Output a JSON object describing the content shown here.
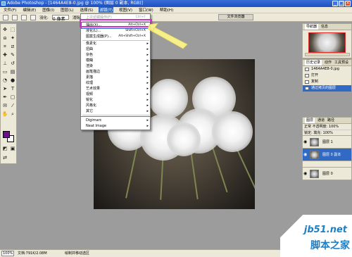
{
  "titlebar": {
    "title": "Adobe Photoshop - [1464A4E8-0.jpg @ 100% (图层 0 副本, RGB)]"
  },
  "menubar": {
    "items": [
      "文件(F)",
      "编辑(E)",
      "图像(I)",
      "图层(L)",
      "选择(S)",
      "滤镜(T)",
      "视图(V)",
      "窗口(W)",
      "帮助(H)"
    ],
    "active_index": 5
  },
  "options": {
    "feather_label": "羽化:",
    "feather_value": "0 像素",
    "smooth_label": "消除锯齿"
  },
  "file_browser": "文件浏览器",
  "filter_menu": {
    "last_filter": {
      "label": "上次滤镜操作(F)",
      "shortcut": "Ctrl+F"
    },
    "top": [
      {
        "label": "抽出(X)...",
        "shortcut": "Alt+Ctrl+X"
      },
      {
        "label": "液化(L)...",
        "shortcut": "Shift+Ctrl+X"
      },
      {
        "label": "图案生成器(P)...",
        "shortcut": "Alt+Shift+Ctrl+X"
      }
    ],
    "groups": [
      "像素化",
      "扭曲",
      "杂色",
      "模糊",
      "渲染",
      "画笔描边",
      "素描",
      "纹理",
      "艺术效果",
      "视频",
      "锐化",
      "风格化",
      "其它"
    ],
    "plugins": [
      "Digimarc",
      "Neat Image"
    ]
  },
  "navigator": {
    "tabs": [
      "导航器",
      "信息"
    ],
    "zoom": "100%"
  },
  "history": {
    "tabs": [
      "历史记录",
      "动作",
      "工具预设"
    ],
    "items": [
      "1464A4E8-0.jpg",
      "打开",
      "复制",
      "通过拷贝的图层"
    ]
  },
  "layers": {
    "tabs": [
      "图层",
      "通道",
      "路径"
    ],
    "blend_mode": "正常",
    "opacity_label": "不透明度:",
    "opacity_value": "100%",
    "lock_label": "锁定:",
    "fill_label": "填充:",
    "fill_value": "100%",
    "items": [
      "图层 1",
      "图层 0 副本",
      "图层 0"
    ],
    "selected_index": 1
  },
  "statusbar": {
    "zoom": "100%",
    "doc": "文档:791K/2.08M",
    "hint": "绘制并移动选区"
  },
  "watermark": {
    "site": "jb51.net",
    "brand": "脚本之家"
  },
  "colors": {
    "foreground": "#6a0f8c",
    "background": "#ffffff",
    "highlight": "#d02fd0",
    "select": "#316ac5"
  }
}
